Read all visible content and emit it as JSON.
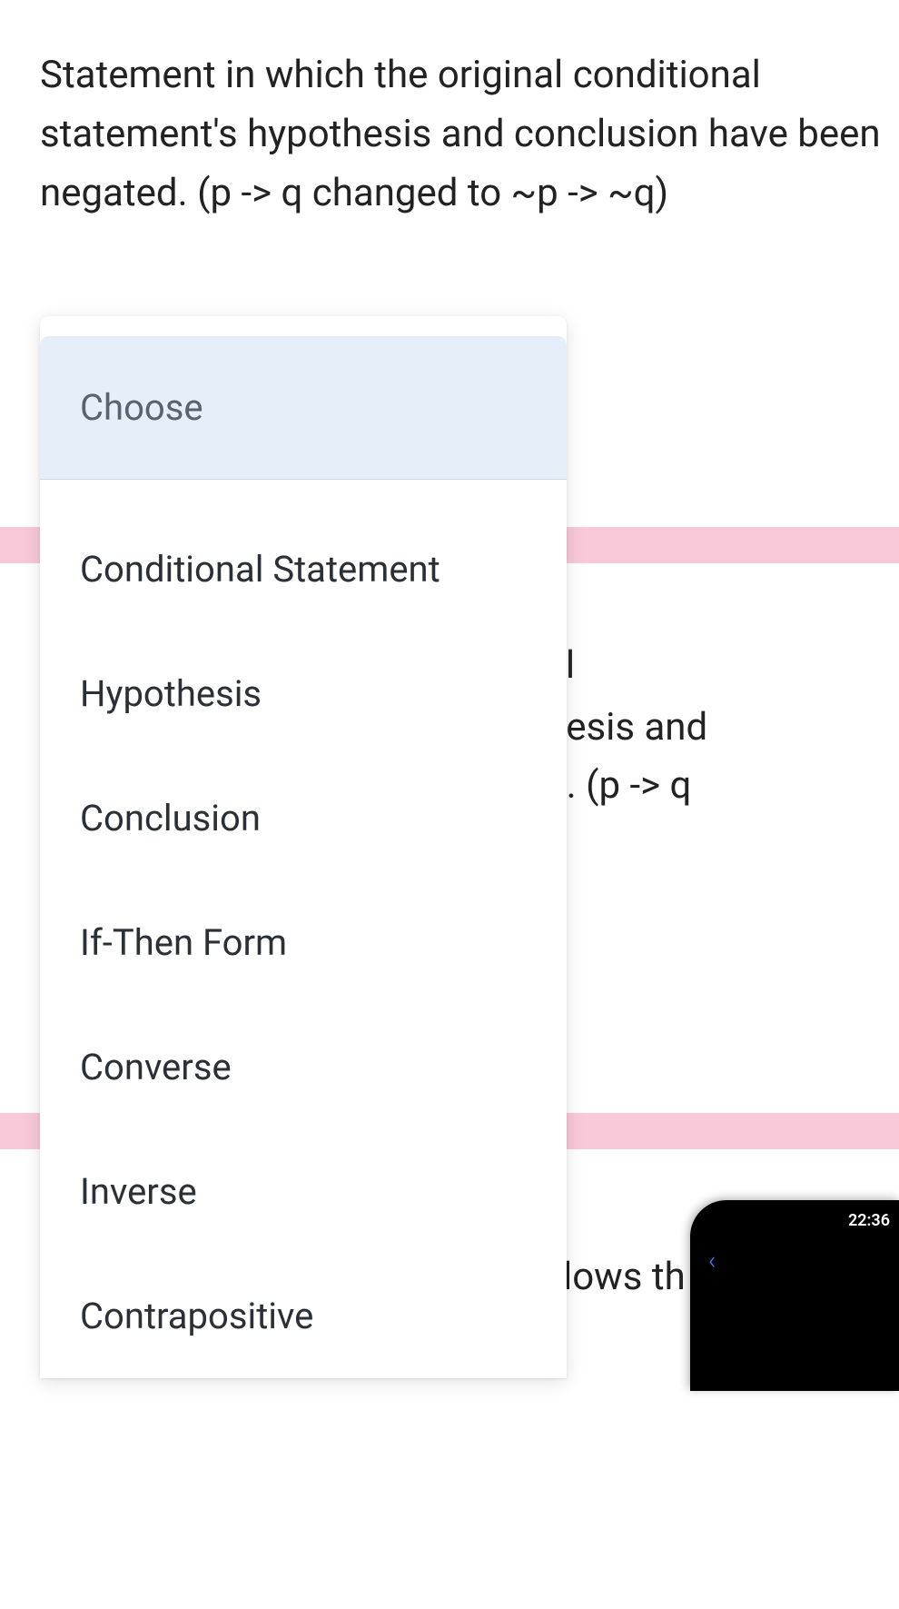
{
  "question": {
    "text": "Statement in which the original conditional statement's hypothesis and conclusion have been negated. (p -> q  changed to ~p -> ~q)"
  },
  "background": {
    "frag1": "al",
    "frag2": "nesis and",
    "frag3": "d. (p -> q",
    "frag4": "lows th"
  },
  "dropdown": {
    "placeholder": "Choose",
    "options": [
      "Conditional Statement",
      "Hypothesis",
      "Conclusion",
      "If-Then Form",
      "Converse",
      "Inverse",
      "Contrapositive"
    ]
  },
  "phone": {
    "time": "22:36",
    "back_glyph": "‹"
  }
}
